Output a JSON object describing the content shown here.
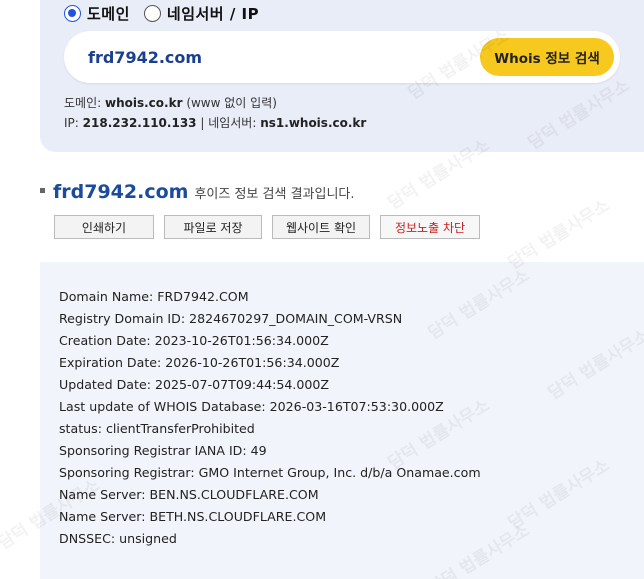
{
  "search": {
    "options": [
      {
        "label": "도메인",
        "checked": true
      },
      {
        "label": "네임서버 / IP",
        "checked": false
      }
    ],
    "value": "frd7942.com",
    "button_label": "Whois 정보 검색"
  },
  "server_info": {
    "domain_prefix": "도메인: ",
    "domain_value": "whois.co.kr",
    "domain_note": " (www 없이 입력)",
    "ip_prefix": "IP: ",
    "ip_value": "218.232.110.133",
    "ns_prefix": " | 네임서버: ",
    "ns_value": "ns1.whois.co.kr"
  },
  "result": {
    "domain": "frd7942.com",
    "caption": "후이즈 정보 검색 결과입니다."
  },
  "actions": [
    "인쇄하기",
    "파일로 저장",
    "웹사이트 확인",
    "정보노출 차단"
  ],
  "whois_lines": [
    "Domain Name: FRD7942.COM",
    "Registry Domain ID: 2824670297_DOMAIN_COM-VRSN",
    "Creation Date: 2023-10-26T01:56:34.000Z",
    "Expiration Date: 2026-10-26T01:56:34.000Z",
    "Updated Date: 2025-07-07T09:44:54.000Z",
    "Last update of WHOIS Database: 2026-03-16T07:53:30.000Z",
    "status: clientTransferProhibited",
    "Sponsoring Registrar IANA ID: 49",
    "Sponsoring Registrar: GMO Internet Group, Inc. d/b/a Onamae.com",
    "Name Server: BEN.NS.CLOUDFLARE.COM",
    "Name Server: BETH.NS.CLOUDFLARE.COM",
    "DNSSEC: unsigned"
  ],
  "watermark_text": "담덕 법률사무소",
  "colors": {
    "panel_bg": "#e9edf8",
    "search_button": "#f7c81e",
    "domain_blue": "#1a4b9c",
    "block_button_red": "#cc1f1f"
  }
}
